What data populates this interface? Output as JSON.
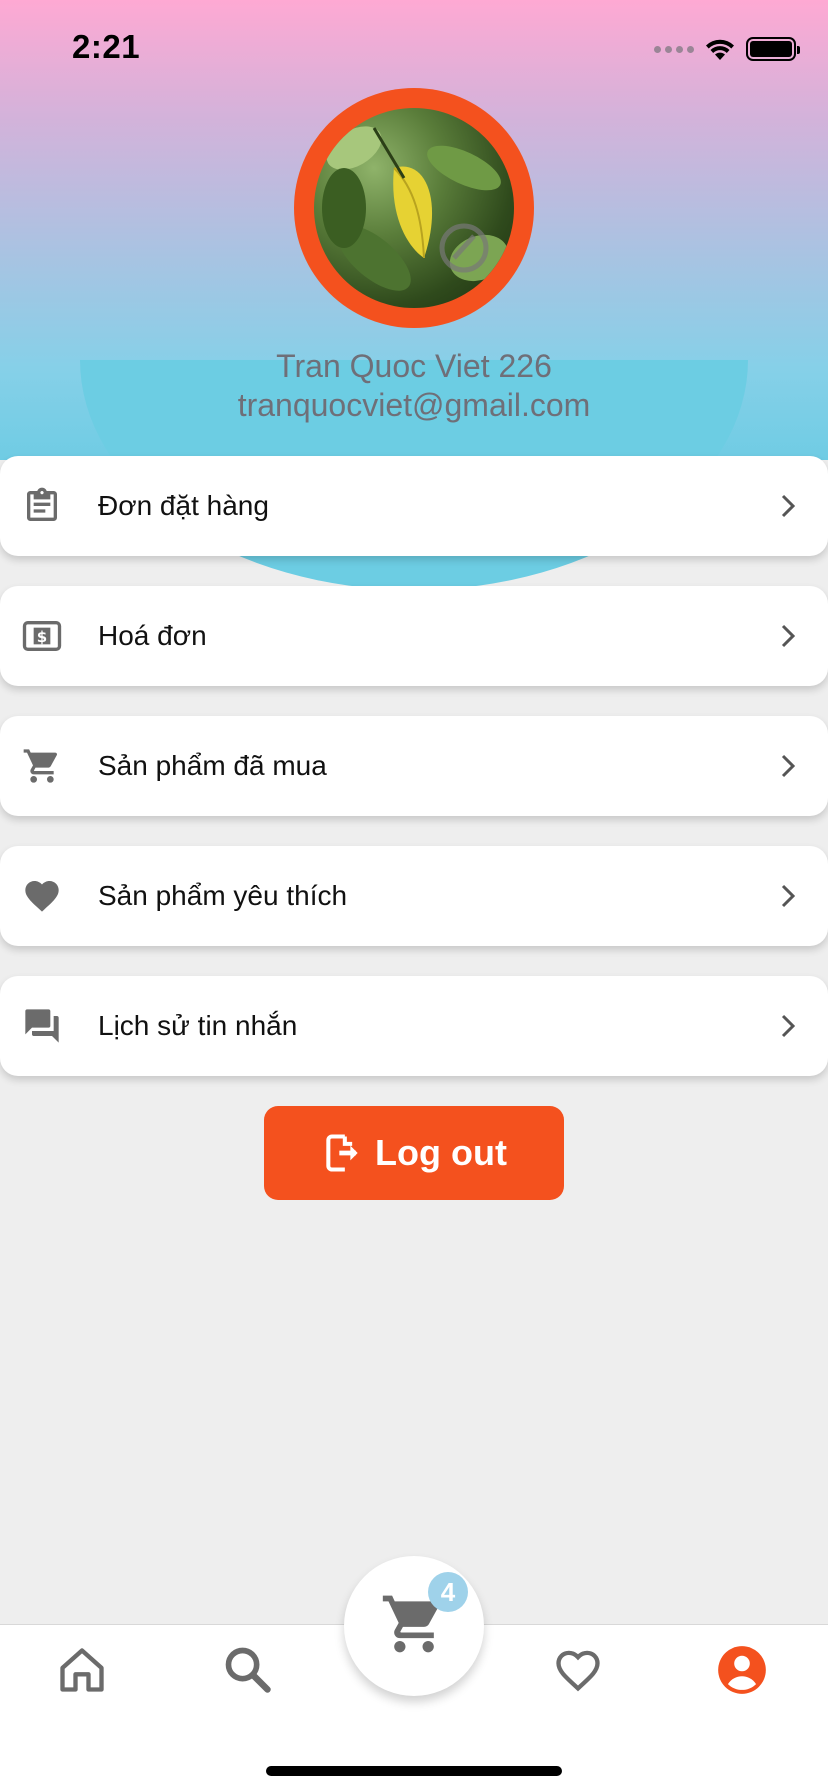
{
  "status_bar": {
    "time": "2:21"
  },
  "profile": {
    "name": "Tran Quoc Viet 226",
    "email": "tranquocviet@gmail.com",
    "avatar_icon": "leaf-photo"
  },
  "menu": {
    "items": [
      {
        "label": "Đơn đặt hàng",
        "icon": "clipboard-icon"
      },
      {
        "label": "Hoá đơn",
        "icon": "dollar-bill-icon"
      },
      {
        "label": "Sản phẩm đã mua",
        "icon": "cart-icon"
      },
      {
        "label": "Sản phẩm yêu thích",
        "icon": "heart-icon"
      },
      {
        "label": "Lịch sử tin nhắn",
        "icon": "chat-icon"
      }
    ]
  },
  "logout": {
    "label": "Log out"
  },
  "bottom_nav": {
    "items": [
      "home",
      "search",
      "cart",
      "favorites",
      "profile"
    ],
    "active": "profile",
    "cart_badge": "4"
  },
  "colors": {
    "accent": "#f4511e",
    "icon_gray": "#6b6b6b",
    "badge": "#9fd2ea"
  }
}
